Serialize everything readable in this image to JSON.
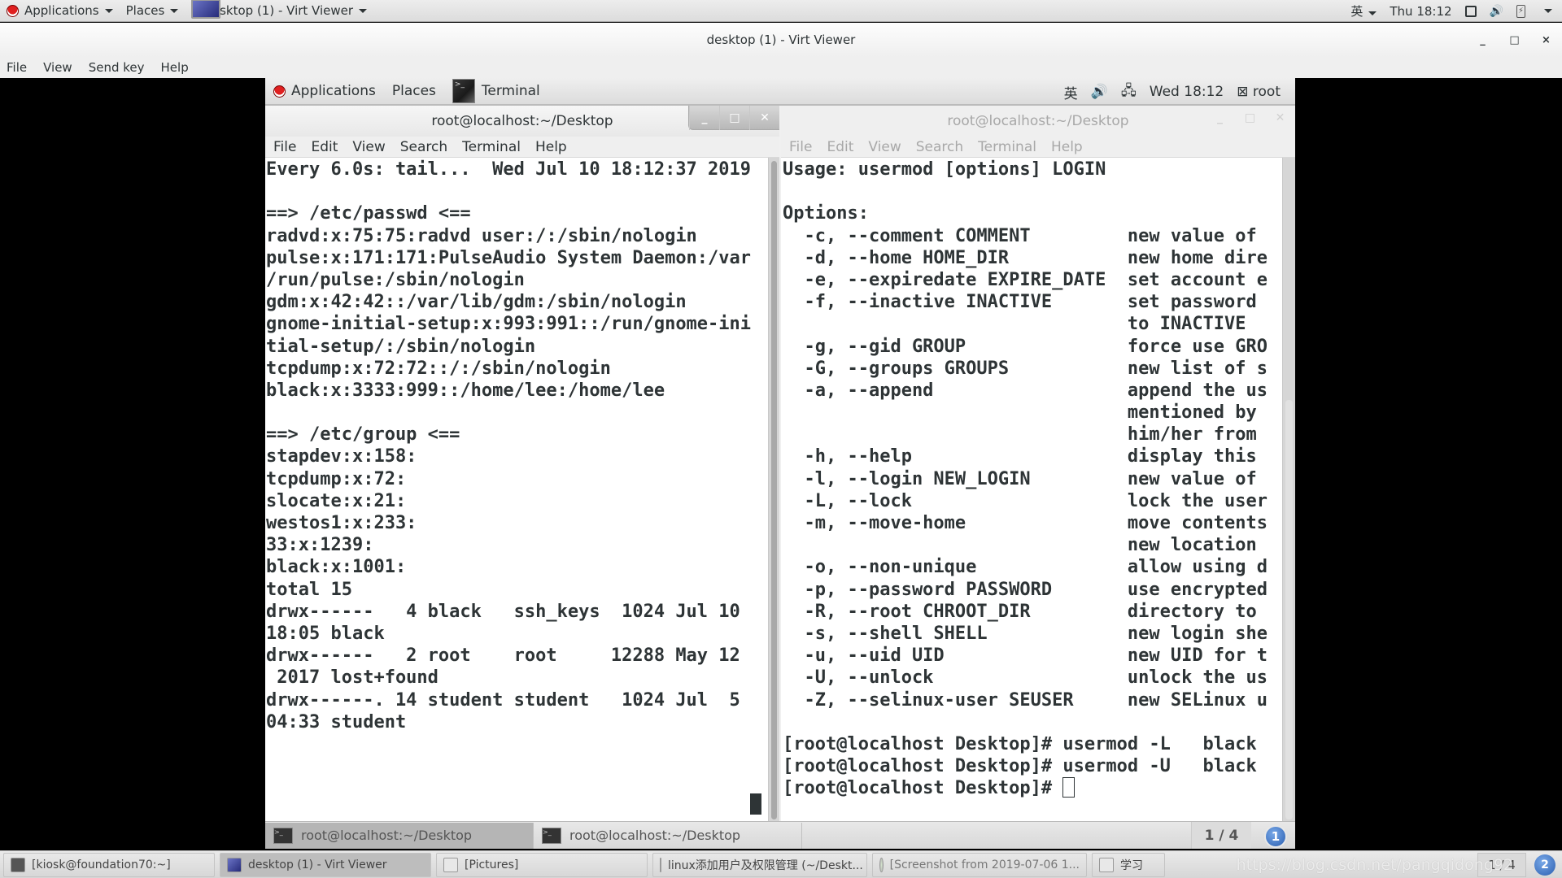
{
  "host_panel": {
    "applications": "Applications",
    "places": "Places",
    "active_window": "desktop (1) - Virt Viewer",
    "input_method": "英",
    "clock": "Thu 18:12"
  },
  "virt_viewer": {
    "title": "desktop (1) - Virt Viewer",
    "menu": [
      "File",
      "View",
      "Send key",
      "Help"
    ],
    "controls": {
      "minimize": "_",
      "maximize": "□",
      "close": "×"
    }
  },
  "guest_panel": {
    "applications": "Applications",
    "places": "Places",
    "active_app": "Terminal",
    "input_method": "英",
    "clock": "Wed 18:12",
    "user": "root"
  },
  "terminal_left": {
    "title": "root@localhost:~/Desktop",
    "menu": [
      "File",
      "Edit",
      "View",
      "Search",
      "Terminal",
      "Help"
    ],
    "lines": [
      "Every 6.0s: tail...  Wed Jul 10 18:12:37 2019",
      "",
      "==> /etc/passwd <==",
      "radvd:x:75:75:radvd user:/:/sbin/nologin",
      "pulse:x:171:171:PulseAudio System Daemon:/var",
      "/run/pulse:/sbin/nologin",
      "gdm:x:42:42::/var/lib/gdm:/sbin/nologin",
      "gnome-initial-setup:x:993:991::/run/gnome-ini",
      "tial-setup/:/sbin/nologin",
      "tcpdump:x:72:72::/:/sbin/nologin",
      "black:x:3333:999::/home/lee:/home/lee",
      "",
      "==> /etc/group <==",
      "stapdev:x:158:",
      "tcpdump:x:72:",
      "slocate:x:21:",
      "westos1:x:233:",
      "33:x:1239:",
      "black:x:1001:",
      "total 15",
      "drwx------   4 black   ssh_keys  1024 Jul 10",
      "18:05 black",
      "drwx------   2 root    root     12288 May 12",
      " 2017 lost+found",
      "drwx------. 14 student student   1024 Jul  5",
      "04:33 student"
    ]
  },
  "terminal_right": {
    "title": "root@localhost:~/Desktop",
    "menu": [
      "File",
      "Edit",
      "View",
      "Search",
      "Terminal",
      "Help"
    ],
    "lines": [
      "Usage: usermod [options] LOGIN",
      "",
      "Options:",
      "  -c, --comment COMMENT         new value of ",
      "  -d, --home HOME_DIR           new home dire",
      "  -e, --expiredate EXPIRE_DATE  set account e",
      "  -f, --inactive INACTIVE       set password ",
      "                                to INACTIVE",
      "  -g, --gid GROUP               force use GRO",
      "  -G, --groups GROUPS           new list of s",
      "  -a, --append                  append the us",
      "                                mentioned by ",
      "                                him/her from ",
      "  -h, --help                    display this ",
      "  -l, --login NEW_LOGIN         new value of ",
      "  -L, --lock                    lock the user",
      "  -m, --move-home               move contents",
      "                                new location ",
      "  -o, --non-unique              allow using d",
      "  -p, --password PASSWORD       use encrypted",
      "  -R, --root CHROOT_DIR         directory to ",
      "  -s, --shell SHELL             new login she",
      "  -u, --uid UID                 new UID for t",
      "  -U, --unlock                  unlock the us",
      "  -Z, --selinux-user SEUSER     new SELinux u",
      "",
      "[root@localhost Desktop]# usermod -L   black",
      "[root@localhost Desktop]# usermod -U   black"
    ],
    "prompt": "[root@localhost Desktop]# "
  },
  "guest_tasklist": {
    "tasks": [
      "root@localhost:~/Desktop",
      "root@localhost:~/Desktop"
    ],
    "workspace": "1 / 4",
    "badge": "1"
  },
  "host_taskbar": {
    "tasks": [
      "[kiosk@foundation70:~]",
      "desktop (1) - Virt Viewer",
      "[Pictures]",
      "linux添加用户及权限管理 (~/Deskt...",
      "[Screenshot from 2019-07-06 1...",
      "学习"
    ],
    "workspace": "1 / 4",
    "badge": "2",
    "watermark": "https://blog.csdn.net/pangqidong92"
  }
}
